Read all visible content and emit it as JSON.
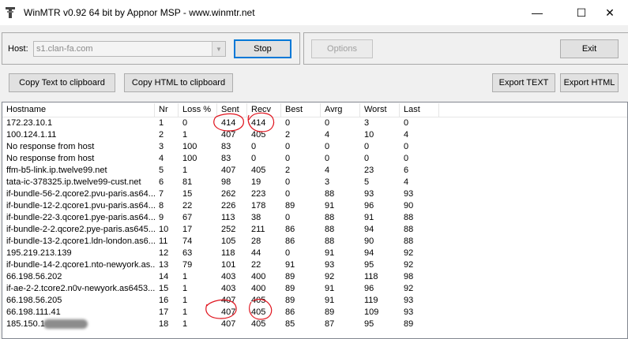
{
  "window": {
    "title": "WinMTR v0.92 64 bit by Appnor MSP - www.winmtr.net",
    "controls": {
      "minimize": "—",
      "maximize": "☐",
      "close": "✕"
    }
  },
  "host": {
    "label": "Host:",
    "value": "s1.clan-fa.com"
  },
  "buttons": {
    "stop": "Stop",
    "options": "Options",
    "exit": "Exit",
    "copy_text": "Copy Text to clipboard",
    "copy_html": "Copy HTML to clipboard",
    "export_text": "Export TEXT",
    "export_html": "Export HTML"
  },
  "table": {
    "columns": [
      "Hostname",
      "Nr",
      "Loss %",
      "Sent",
      "Recv",
      "Best",
      "Avrg",
      "Worst",
      "Last"
    ],
    "rows": [
      [
        "172.23.10.1",
        "1",
        "0",
        "414",
        "414",
        "0",
        "0",
        "3",
        "0"
      ],
      [
        "100.124.1.11",
        "2",
        "1",
        "407",
        "405",
        "2",
        "4",
        "10",
        "4"
      ],
      [
        "No response from host",
        "3",
        "100",
        "83",
        "0",
        "0",
        "0",
        "0",
        "0"
      ],
      [
        "No response from host",
        "4",
        "100",
        "83",
        "0",
        "0",
        "0",
        "0",
        "0"
      ],
      [
        "ffm-b5-link.ip.twelve99.net",
        "5",
        "1",
        "407",
        "405",
        "2",
        "4",
        "23",
        "6"
      ],
      [
        "tata-ic-378325.ip.twelve99-cust.net",
        "6",
        "81",
        "98",
        "19",
        "0",
        "3",
        "5",
        "4"
      ],
      [
        "if-bundle-56-2.qcore2.pvu-paris.as64...",
        "7",
        "15",
        "262",
        "223",
        "0",
        "88",
        "93",
        "93"
      ],
      [
        "if-bundle-12-2.qcore1.pvu-paris.as64...",
        "8",
        "22",
        "226",
        "178",
        "89",
        "91",
        "96",
        "90"
      ],
      [
        "if-bundle-22-3.qcore1.pye-paris.as64...",
        "9",
        "67",
        "113",
        "38",
        "0",
        "88",
        "91",
        "88"
      ],
      [
        "if-bundle-2-2.qcore2.pye-paris.as645...",
        "10",
        "17",
        "252",
        "211",
        "86",
        "88",
        "94",
        "88"
      ],
      [
        "if-bundle-13-2.qcore1.ldn-london.as6...",
        "11",
        "74",
        "105",
        "28",
        "86",
        "88",
        "90",
        "88"
      ],
      [
        "195.219.213.139",
        "12",
        "63",
        "118",
        "44",
        "0",
        "91",
        "94",
        "92"
      ],
      [
        "if-bundle-14-2.qcore1.nto-newyork.as...",
        "13",
        "79",
        "101",
        "22",
        "91",
        "93",
        "95",
        "92"
      ],
      [
        "66.198.56.202",
        "14",
        "1",
        "403",
        "400",
        "89",
        "92",
        "118",
        "98"
      ],
      [
        "if-ae-2-2.tcore2.n0v-newyork.as6453...",
        "15",
        "1",
        "403",
        "400",
        "89",
        "91",
        "96",
        "92"
      ],
      [
        "66.198.56.205",
        "16",
        "1",
        "407",
        "405",
        "89",
        "91",
        "119",
        "93"
      ],
      [
        "66.198.111.41",
        "17",
        "1",
        "407",
        "405",
        "86",
        "89",
        "109",
        "93"
      ],
      [
        "185.150.1",
        "18",
        "1",
        "407",
        "405",
        "85",
        "87",
        "95",
        "89"
      ]
    ]
  }
}
